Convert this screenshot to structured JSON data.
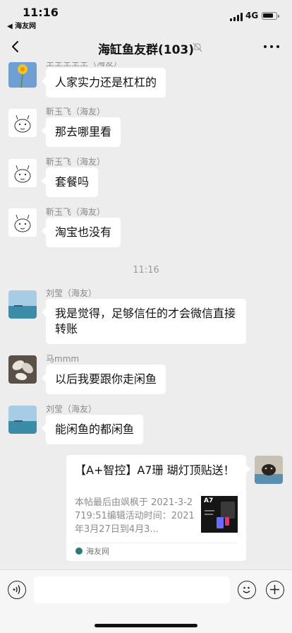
{
  "status_bar": {
    "time": "11:16",
    "back_app": "◀ 海友网",
    "network": "4G"
  },
  "nav": {
    "title": "海缸鱼友群(103)"
  },
  "messages": [
    {
      "sender": "王王王王王（海友）",
      "text": "人家实力还是杠杠的",
      "avatar": "flower-avatar"
    },
    {
      "sender": "靳玉飞（海友）",
      "text": "那去哪里看",
      "avatar": "cartoon-sketch-avatar"
    },
    {
      "sender": "靳玉飞（海友）",
      "text": "套餐吗",
      "avatar": "cartoon-sketch-avatar"
    },
    {
      "sender": "靳玉飞（海友）",
      "text": "淘宝也没有",
      "avatar": "cartoon-sketch-avatar"
    },
    {
      "sender": "刘莹（海友）",
      "text": "我是觉得，足够信任的才会微信直接转账",
      "avatar": "sea-avatar"
    },
    {
      "sender": "马mmm",
      "text": "以后我要跟你走闲鱼",
      "avatar": "leaves-avatar"
    },
    {
      "sender": "刘莹（海友）",
      "text": "能闲鱼的都闲鱼",
      "avatar": "sea-avatar"
    }
  ],
  "time_divider": "11:16",
  "card": {
    "title": "【A+智控】A7珊 瑚灯顶贴送！",
    "description": "本帖最后由飒枫于 2021-3-2719:51编辑活动时间：2021年3月27日到4月3...",
    "thumb_label": "A7",
    "source": "海友网",
    "avatar": "dog-avatar"
  },
  "input": {
    "placeholder": ""
  },
  "colors": {
    "background": "#ededed",
    "bubble": "#ffffff",
    "meta_text": "#8a8a8a"
  }
}
